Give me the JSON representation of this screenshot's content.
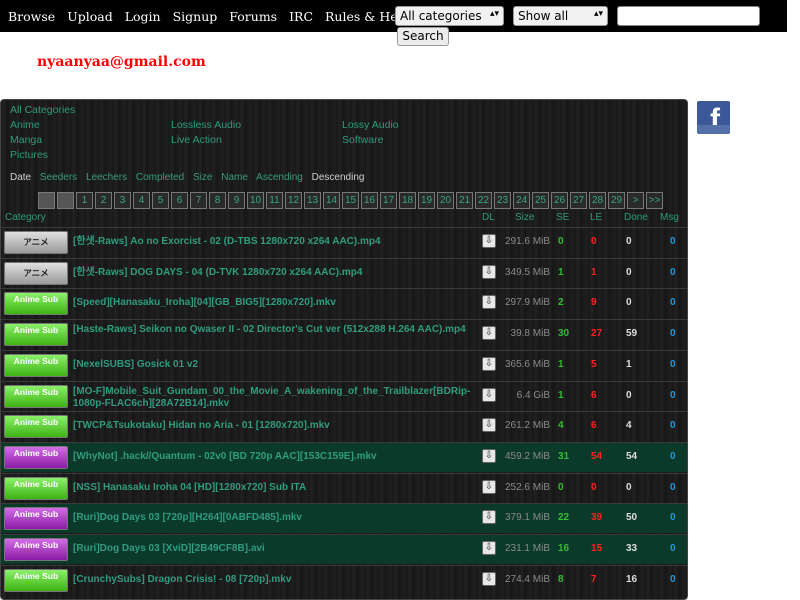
{
  "nav": {
    "items": [
      "Browse",
      "Upload",
      "Login",
      "Signup",
      "Forums",
      "IRC",
      "Rules & Help"
    ]
  },
  "search": {
    "category_select": "All categories",
    "filter_select": "Show all",
    "input_value": "",
    "button_label": "Search"
  },
  "user": {
    "email": "nyaanyaa@gmail.com"
  },
  "categories": {
    "all": "All Categories",
    "items": [
      "Anime",
      "Lossless Audio",
      "Lossy Audio",
      "Manga",
      "Live Action",
      "Software",
      "Pictures"
    ]
  },
  "sort": {
    "items": [
      "Date",
      "Seeders",
      "Leechers",
      "Completed",
      "Size",
      "Name",
      "Ascending",
      "Descending"
    ],
    "active": [
      "Date",
      "Descending"
    ]
  },
  "pager": {
    "pages": [
      "1",
      "2",
      "3",
      "4",
      "5",
      "6",
      "7",
      "8",
      "9",
      "10",
      "11",
      "12",
      "13",
      "14",
      "15",
      "16",
      "17",
      "18",
      "19",
      "20",
      "21",
      "22",
      "23",
      "24",
      "25",
      "26",
      "27",
      "28",
      "29",
      ">",
      ">>"
    ]
  },
  "table": {
    "headers": {
      "category": "Category",
      "dl": "DL",
      "size": "Size",
      "se": "SE",
      "le": "LE",
      "done": "Done",
      "msg": "Msg"
    },
    "rows": [
      {
        "cat": "raw",
        "cat_label": "アニメ",
        "name": "[한샛-Raws] Ao no Exorcist - 02 (D-TBS 1280x720 x264 AAC).mp4",
        "size": "291.6 MiB",
        "se": "0",
        "le": "0",
        "done": "0",
        "msg": "0",
        "trusted": false
      },
      {
        "cat": "raw",
        "cat_label": "アニメ",
        "name": "[한샛-Raws] DOG DAYS - 04 (D-TVK 1280x720 x264 AAC).mp4",
        "size": "349.5 MiB",
        "se": "1",
        "le": "1",
        "done": "0",
        "msg": "0",
        "trusted": false
      },
      {
        "cat": "eng",
        "cat_label": "Anime Sub",
        "name": "[Speed][Hanasaku_Iroha][04][GB_BIG5][1280x720].mkv",
        "size": "297.9 MiB",
        "se": "2",
        "le": "9",
        "done": "0",
        "msg": "0",
        "trusted": false
      },
      {
        "cat": "eng",
        "cat_label": "Anime Sub",
        "name": "[Haste-Raws] Seikon no Qwaser II - 02 Director's Cut ver (512x288 H.264 AAC).mp4",
        "size": "39.8 MiB",
        "se": "30",
        "le": "27",
        "done": "59",
        "msg": "0",
        "trusted": false
      },
      {
        "cat": "eng",
        "cat_label": "Anime Sub",
        "name": "[NexelSUBS] Gosick 01 v2",
        "size": "365.6 MiB",
        "se": "1",
        "le": "5",
        "done": "1",
        "msg": "0",
        "trusted": false
      },
      {
        "cat": "eng",
        "cat_label": "Anime Sub",
        "name": "[MO-F]Mobile_Suit_Gundam_00_the_Movie_A_wakening_of_the_Trailblazer[BDRip-1080p-FLAC6ch][28A72B14].mkv",
        "size": "6.4 GiB",
        "se": "1",
        "le": "6",
        "done": "0",
        "msg": "0",
        "trusted": false
      },
      {
        "cat": "eng",
        "cat_label": "Anime Sub",
        "name": "[TWCP&Tsukotaku] Hidan no Aria - 01 [1280x720].mkv",
        "size": "261.2 MiB",
        "se": "4",
        "le": "6",
        "done": "4",
        "msg": "0",
        "trusted": false
      },
      {
        "cat": "nen",
        "cat_label": "Anime Sub",
        "name": "[WhyNot] .hack//Quantum - 02v0 [BD 720p AAC][153C159E].mkv",
        "size": "459.2 MiB",
        "se": "31",
        "le": "54",
        "done": "54",
        "msg": "0",
        "trusted": true
      },
      {
        "cat": "eng",
        "cat_label": "Anime Sub",
        "name": "[NSS] Hanasaku Iroha 04 [HD][1280x720] Sub ITA",
        "size": "252.6 MiB",
        "se": "0",
        "le": "0",
        "done": "0",
        "msg": "0",
        "trusted": false
      },
      {
        "cat": "nen",
        "cat_label": "Anime Sub",
        "name": "[Ruri]Dog Days 03 [720p][H264][0ABFD485].mkv",
        "size": "379.1 MiB",
        "se": "22",
        "le": "39",
        "done": "50",
        "msg": "0",
        "trusted": true
      },
      {
        "cat": "nen",
        "cat_label": "Anime Sub",
        "name": "[Ruri]Dog Days 03 [XviD][2B49CF8B].avi",
        "size": "231.1 MiB",
        "se": "16",
        "le": "15",
        "done": "33",
        "msg": "0",
        "trusted": true
      },
      {
        "cat": "eng",
        "cat_label": "Anime Sub",
        "name": "[CrunchySubs] Dragon Crisis! - 08 [720p].mkv",
        "size": "274.4 MiB",
        "se": "8",
        "le": "7",
        "done": "16",
        "msg": "0",
        "trusted": false
      }
    ]
  },
  "colors": {
    "seeders": "#2fbf2f",
    "leechers": "#ff2020",
    "link": "#2f9c7e",
    "trusted_row": "#0c3a2a",
    "email": "#ff0000"
  }
}
